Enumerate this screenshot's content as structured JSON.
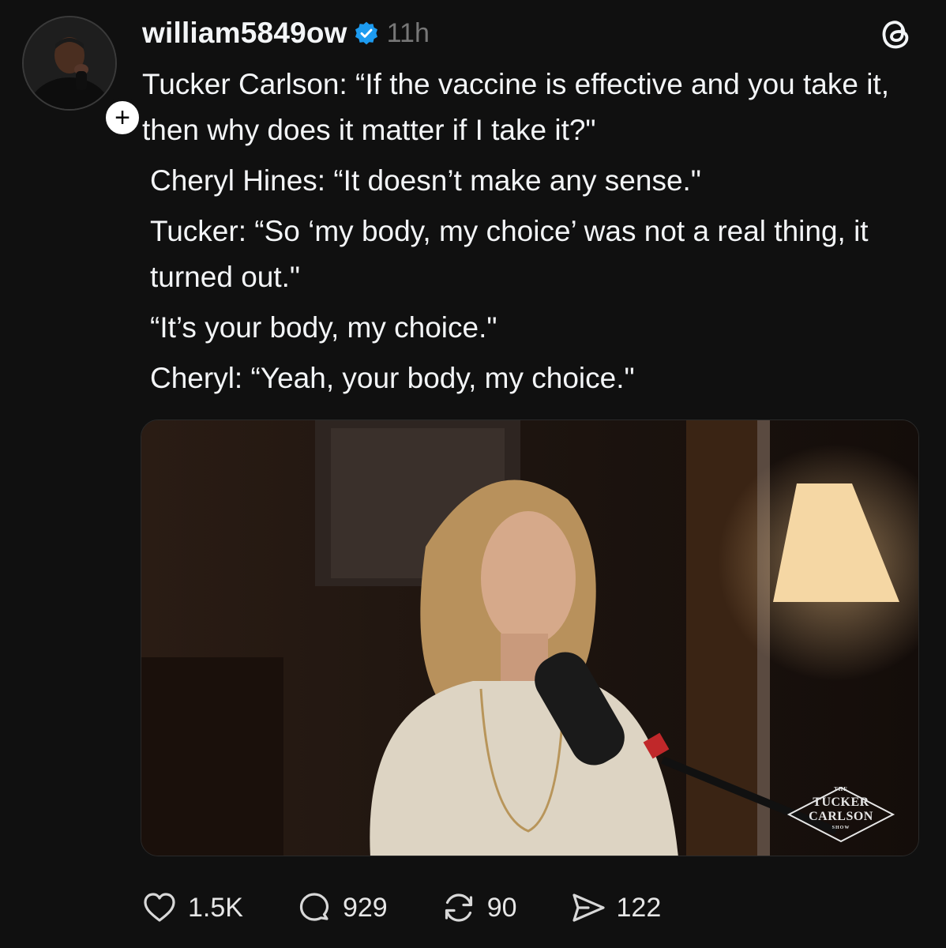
{
  "post": {
    "author": {
      "username": "william5849ow",
      "verified": true,
      "verified_color": "#1d9bf0",
      "follow_icon_label": "+"
    },
    "timestamp": "11h",
    "app_icon": "threads-logo-icon",
    "paragraphs": [
      "Tucker Carlson: “If the vaccine is effective and you take it, then why does it matter if I take it?\"",
      "Cheryl Hines: “It doesn’t make any sense.\"",
      "Tucker: “So ‘my body, my choice’ was not a real thing, it turned out.\"",
      "“It’s your body, my choice.\"",
      "Cheryl: “Yeah, your body, my choice.\""
    ],
    "media": {
      "watermark": {
        "the": "THE",
        "line1": "TUCKER",
        "line2": "CARLSON",
        "show": "SHOW"
      }
    },
    "actions": {
      "like": {
        "icon": "heart-icon",
        "count": "1.5K"
      },
      "reply": {
        "icon": "comment-icon",
        "count": "929"
      },
      "repost": {
        "icon": "repost-icon",
        "count": "90"
      },
      "share": {
        "icon": "send-icon",
        "count": "122"
      }
    }
  }
}
